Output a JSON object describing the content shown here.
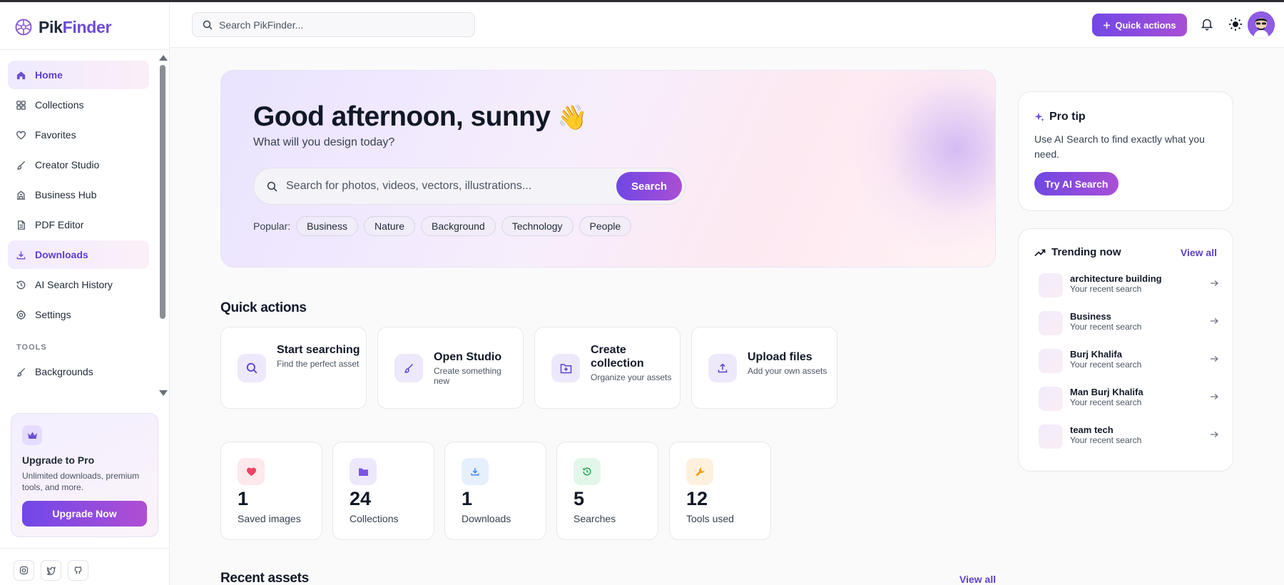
{
  "app": {
    "logo_part1": "Pik",
    "logo_part2": "Finder",
    "brand_color": "#6d4bd8"
  },
  "topbar": {
    "search_placeholder": "Search PikFinder...",
    "quick_actions_label": "Quick actions"
  },
  "sidebar": {
    "items": [
      {
        "label": "Home",
        "icon": "home-icon"
      },
      {
        "label": "Collections",
        "icon": "grid-icon"
      },
      {
        "label": "Favorites",
        "icon": "heart-icon"
      },
      {
        "label": "Creator Studio",
        "icon": "brush-icon"
      },
      {
        "label": "Business Hub",
        "icon": "building-icon"
      },
      {
        "label": "PDF Editor",
        "icon": "document-icon"
      },
      {
        "label": "Downloads",
        "icon": "download-icon"
      },
      {
        "label": "AI Search History",
        "icon": "history-icon"
      },
      {
        "label": "Settings",
        "icon": "gear-icon"
      }
    ],
    "tools_heading": "TOOLS",
    "tools": [
      {
        "label": "Backgrounds",
        "icon": "brush-icon"
      }
    ],
    "upgrade": {
      "title": "Upgrade to Pro",
      "description": "Unlimited downloads, premium tools, and more.",
      "button": "Upgrade Now"
    }
  },
  "hero": {
    "greeting": "Good afternoon, sunny",
    "emoji": "👋",
    "subtitle": "What will you design today?",
    "search_placeholder": "Search for photos, videos, vectors, illustrations...",
    "search_button": "Search",
    "popular_label": "Popular:",
    "popular_tags": [
      "Business",
      "Nature",
      "Background",
      "Technology",
      "People"
    ]
  },
  "quick_actions": {
    "title": "Quick actions",
    "cards": [
      {
        "title": "Start searching",
        "desc": "Find the perfect asset",
        "icon": "search-icon"
      },
      {
        "title": "Open Studio",
        "desc": "Create something new",
        "icon": "brush-icon"
      },
      {
        "title": "Create collection",
        "desc": "Organize your assets",
        "icon": "folder-plus-icon"
      },
      {
        "title": "Upload files",
        "desc": "Add your own assets",
        "icon": "upload-icon"
      }
    ]
  },
  "stats": [
    {
      "value": "1",
      "label": "Saved images",
      "icon": "heart-icon",
      "color": "#ef4463"
    },
    {
      "value": "24",
      "label": "Collections",
      "icon": "folder-icon",
      "color": "#7c55e3"
    },
    {
      "value": "1",
      "label": "Downloads",
      "icon": "download-icon",
      "color": "#3b82f6"
    },
    {
      "value": "5",
      "label": "Searches",
      "icon": "history-icon",
      "color": "#16a34a"
    },
    {
      "value": "12",
      "label": "Tools used",
      "icon": "wrench-icon",
      "color": "#f59e0b"
    }
  ],
  "recent": {
    "title": "Recent assets",
    "view_all": "View all"
  },
  "pro_tip": {
    "title": "Pro tip",
    "text": "Use AI Search to find exactly what you need.",
    "button": "Try AI Search"
  },
  "trending": {
    "title": "Trending now",
    "view_all": "View all",
    "items": [
      {
        "name": "architecture building",
        "sub": "Your recent search"
      },
      {
        "name": "Business",
        "sub": "Your recent search"
      },
      {
        "name": "Burj Khalifa",
        "sub": "Your recent search"
      },
      {
        "name": "Man Burj Khalifa",
        "sub": "Your recent search"
      },
      {
        "name": "team tech",
        "sub": "Your recent search"
      }
    ]
  }
}
